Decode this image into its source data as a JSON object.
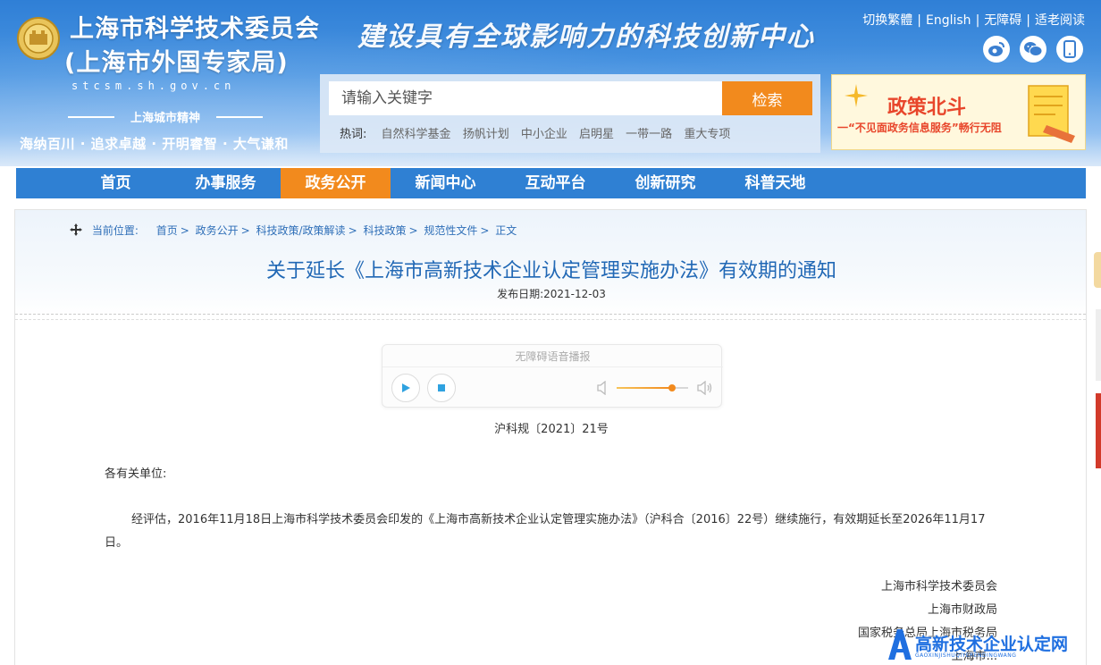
{
  "header": {
    "site_name_line1": "上海市科学技术委员会",
    "site_name_line2": "(上海市外国专家局)",
    "domain": "stcsm.sh.gov.cn",
    "spirit_title": "上海城市精神",
    "spirit_text": "海纳百川 · 追求卓越 · 开明睿智 · 大气谦和",
    "slogan": "建设具有全球影响力的科技创新中心",
    "top_links": [
      "切换繁體",
      "English",
      "无障碍",
      "适老阅读"
    ],
    "social_icons": [
      "weibo-icon",
      "wechat-icon",
      "mobile-icon"
    ]
  },
  "search": {
    "placeholder": "请输入关键字",
    "button_label": "检索",
    "hot_label": "热词:",
    "hot_words": [
      "自然科学基金",
      "扬帆计划",
      "中小企业",
      "启明星",
      "一带一路",
      "重大专项"
    ]
  },
  "promo": {
    "title": "政策北斗",
    "subtitle": "一“不见面政务信息服务”畅行无阻"
  },
  "nav": {
    "items": [
      "首页",
      "办事服务",
      "政务公开",
      "新闻中心",
      "互动平台",
      "创新研究",
      "科普天地"
    ],
    "active": "政务公开"
  },
  "breadcrumb": {
    "label": "当前位置:",
    "items": [
      "首页",
      "政务公开",
      "科技政策/政策解读",
      "科技政策",
      "规范性文件",
      "正文"
    ]
  },
  "article": {
    "title": "关于延长《上海市高新技术企业认定管理实施办法》有效期的通知",
    "date_label": "发布日期:",
    "date": "2021-12-03",
    "doc_number": "沪科规〔2021〕21号",
    "greeting": "各有关单位:",
    "body": "经评估，2016年11月18日上海市科学技术委员会印发的《上海市高新技术企业认定管理实施办法》（沪科合〔2016〕22号）继续施行，有效期延长至2026年11月17日。",
    "signatories": [
      "上海市科学技术委员会",
      "上海市财政局",
      "国家税务总局上海市税务局",
      "上海市..."
    ]
  },
  "player": {
    "title": "无障碍语音播报",
    "volume_level": 0.78
  },
  "watermark": {
    "text": "高新技术企业认定网",
    "sub": "GAOXINJISHUQIYERENDINGWANG"
  },
  "colors": {
    "nav_bg": "#2f80d3",
    "accent_orange": "#f28a1d",
    "title_blue": "#2168b5",
    "link_blue": "#2f6fb8"
  }
}
